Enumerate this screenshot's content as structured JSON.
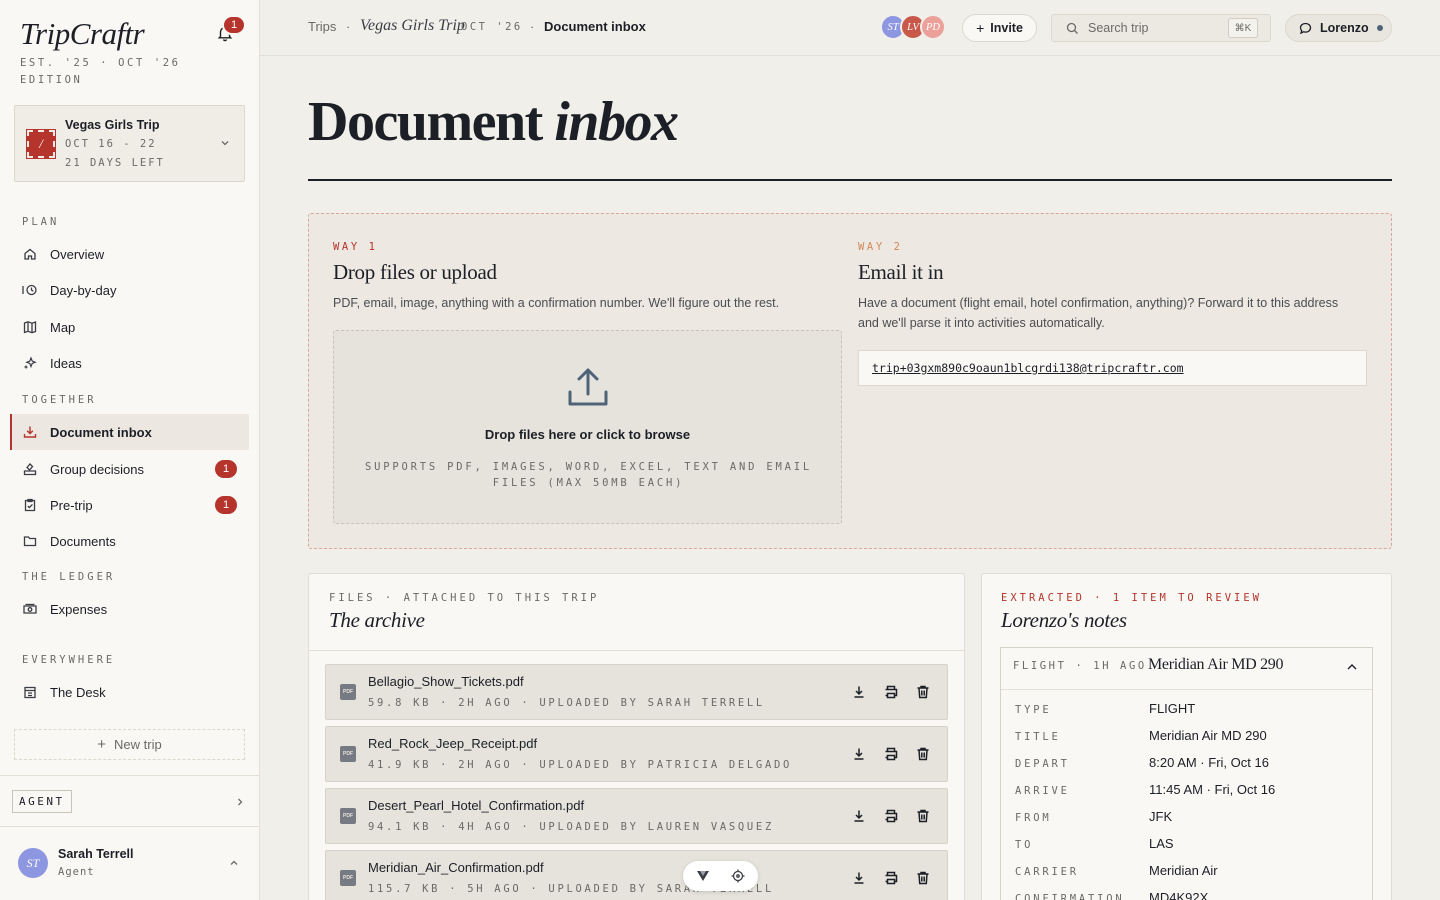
{
  "app": {
    "logo": "TripCraftr",
    "edition": "EST. '25 · OCT '26 EDITION",
    "notifications_count": "1"
  },
  "trip_card": {
    "stamp": "/",
    "name": "Vegas Girls Trip",
    "dates": "OCT 16 - 22",
    "days_left": "21 DAYS LEFT"
  },
  "sidebar": {
    "sections": {
      "plan": "PLAN",
      "together": "TOGETHER",
      "ledger": "THE LEDGER",
      "everywhere": "EVERYWHERE"
    },
    "items": [
      {
        "label": "Overview",
        "icon": "home-icon"
      },
      {
        "label": "Day-by-day",
        "icon": "timeline-clock-icon"
      },
      {
        "label": "Map",
        "icon": "map-icon"
      },
      {
        "label": "Ideas",
        "icon": "sparkle-icon"
      },
      {
        "label": "Document inbox",
        "icon": "download-tray-icon",
        "active": true
      },
      {
        "label": "Group decisions",
        "icon": "vote-icon",
        "badge": "1"
      },
      {
        "label": "Pre-trip",
        "icon": "clipboard-check-icon",
        "badge": "1"
      },
      {
        "label": "Documents",
        "icon": "folder-icon"
      },
      {
        "label": "Expenses",
        "icon": "cash-icon"
      },
      {
        "label": "The Desk",
        "icon": "desk-icon"
      }
    ],
    "new_trip": "New trip",
    "agent_label": "AGENT"
  },
  "user": {
    "initials": "ST",
    "name": "Sarah Terrell",
    "role": "Agent"
  },
  "topbar": {
    "crumb_trips": "Trips",
    "crumb_trip": "Vegas Girls Trip",
    "crumb_date": "OCT '26",
    "crumb_current": "Document inbox",
    "avatars": [
      {
        "initials": "ST",
        "color": "#8d96e0"
      },
      {
        "initials": "LV",
        "color": "#c8584a"
      },
      {
        "initials": "PD",
        "color": "#eba09a"
      }
    ],
    "invite": "Invite",
    "search_placeholder": "Search trip",
    "search_kbd": "⌘K",
    "current_user": "Lorenzo"
  },
  "page": {
    "title_plain": "Document",
    "title_italic": "inbox"
  },
  "ways": {
    "way1": {
      "label": "WAY 1",
      "title": "Drop files or upload",
      "desc": "PDF, email, image, anything with a confirmation number. We'll figure out the rest.",
      "drop_text": "Drop files here or click to browse",
      "drop_sub": "SUPPORTS PDF, IMAGES, WORD, EXCEL, TEXT AND EMAIL FILES (MAX 50MB EACH)"
    },
    "way2": {
      "label": "WAY 2",
      "title": "Email it in",
      "desc": "Have a document (flight email, hotel confirmation, anything)? Forward it to this address and we'll parse it into activities automatically.",
      "email": "trip+03gxm890c9oaun1blcgrdi138@tripcraftr.com"
    }
  },
  "archive": {
    "kicker": "FILES · ATTACHED TO THIS TRIP",
    "title": "The archive",
    "files": [
      {
        "name": "Bellagio_Show_Tickets.pdf",
        "meta": "59.8 KB · 2H AGO · UPLOADED BY SARAH TERRELL"
      },
      {
        "name": "Red_Rock_Jeep_Receipt.pdf",
        "meta": "41.9 KB · 2H AGO · UPLOADED BY PATRICIA DELGADO"
      },
      {
        "name": "Desert_Pearl_Hotel_Confirmation.pdf",
        "meta": "94.1 KB · 4H AGO · UPLOADED BY LAUREN VASQUEZ"
      },
      {
        "name": "Meridian_Air_Confirmation.pdf",
        "meta": "115.7 KB · 5H AGO · UPLOADED BY SARAH TERRELL"
      }
    ],
    "file_icon_text": "PDF"
  },
  "notes": {
    "kicker": "EXTRACTED · 1 ITEM TO REVIEW",
    "title": "Lorenzo's notes",
    "card": {
      "kind": "FLIGHT · 1H AGO",
      "heading": "Meridian Air MD 290",
      "fields": [
        {
          "key": "TYPE",
          "value": "FLIGHT"
        },
        {
          "key": "TITLE",
          "value": "Meridian Air MD 290"
        },
        {
          "key": "DEPART",
          "value": "8:20 AM · Fri, Oct 16"
        },
        {
          "key": "ARRIVE",
          "value": "11:45 AM · Fri, Oct 16"
        },
        {
          "key": "FROM",
          "value": "JFK"
        },
        {
          "key": "TO",
          "value": "LAS"
        },
        {
          "key": "CARRIER",
          "value": "Meridian Air"
        },
        {
          "key": "CONFIRMATION",
          "value": "MD4K92X"
        }
      ]
    }
  },
  "colors": {
    "accent_red": "#b5342b",
    "way2_orange": "#d08a5a",
    "ink": "#1c1f26"
  }
}
